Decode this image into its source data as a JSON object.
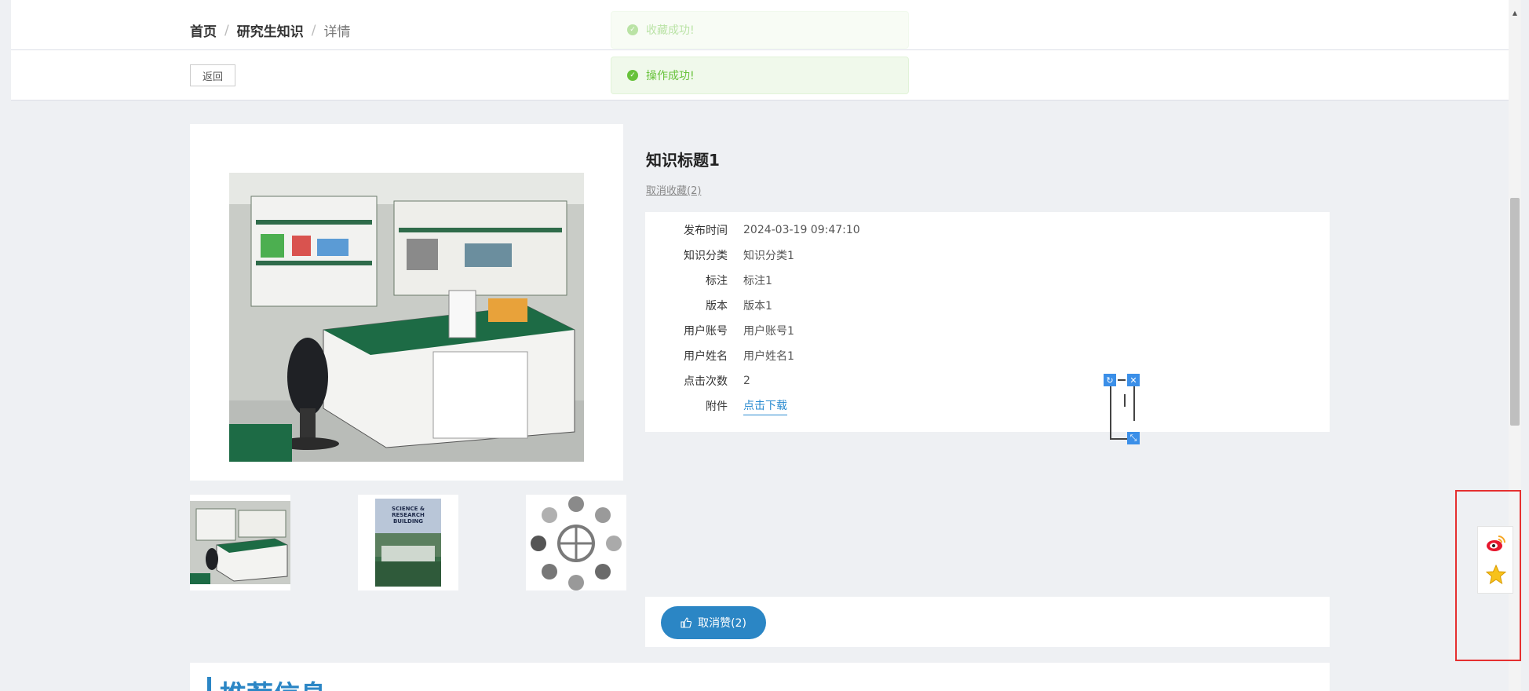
{
  "breadcrumb": {
    "home": "首页",
    "section": "研究生知识",
    "current": "详情",
    "separator": "/"
  },
  "toolbar": {
    "back_label": "返回"
  },
  "toasts": {
    "faded": "收藏成功!",
    "main": "操作成功!",
    "check_glyph": "✓"
  },
  "knowledge": {
    "title": "知识标题1",
    "unfavorite_link": "取消收藏(2)",
    "fields": [
      {
        "label": "发布时间",
        "value": "2024-03-19 09:47:10"
      },
      {
        "label": "知识分类",
        "value": "知识分类1"
      },
      {
        "label": "标注",
        "value": "标注1"
      },
      {
        "label": "版本",
        "value": "版本1"
      },
      {
        "label": "用户账号",
        "value": "用户账号1"
      },
      {
        "label": "用户姓名",
        "value": "用户姓名1"
      },
      {
        "label": "点击次数",
        "value": "2"
      },
      {
        "label": "附件",
        "value": "点击下载"
      }
    ]
  },
  "thumbnails": [
    {
      "name": "lab-thumb"
    },
    {
      "name": "book-thumb",
      "caption": "SCIENCE & RESEARCH BUILDING"
    },
    {
      "name": "science-icons-thumb"
    }
  ],
  "like": {
    "label": "取消赞(2)"
  },
  "recommend": {
    "title": "推荐信息"
  },
  "social": {
    "icons": [
      "weibo-icon",
      "favorite-star-icon"
    ]
  },
  "colors": {
    "accent": "#2b86c5",
    "success": "#67c23a",
    "highlight_border": "#e53030"
  }
}
